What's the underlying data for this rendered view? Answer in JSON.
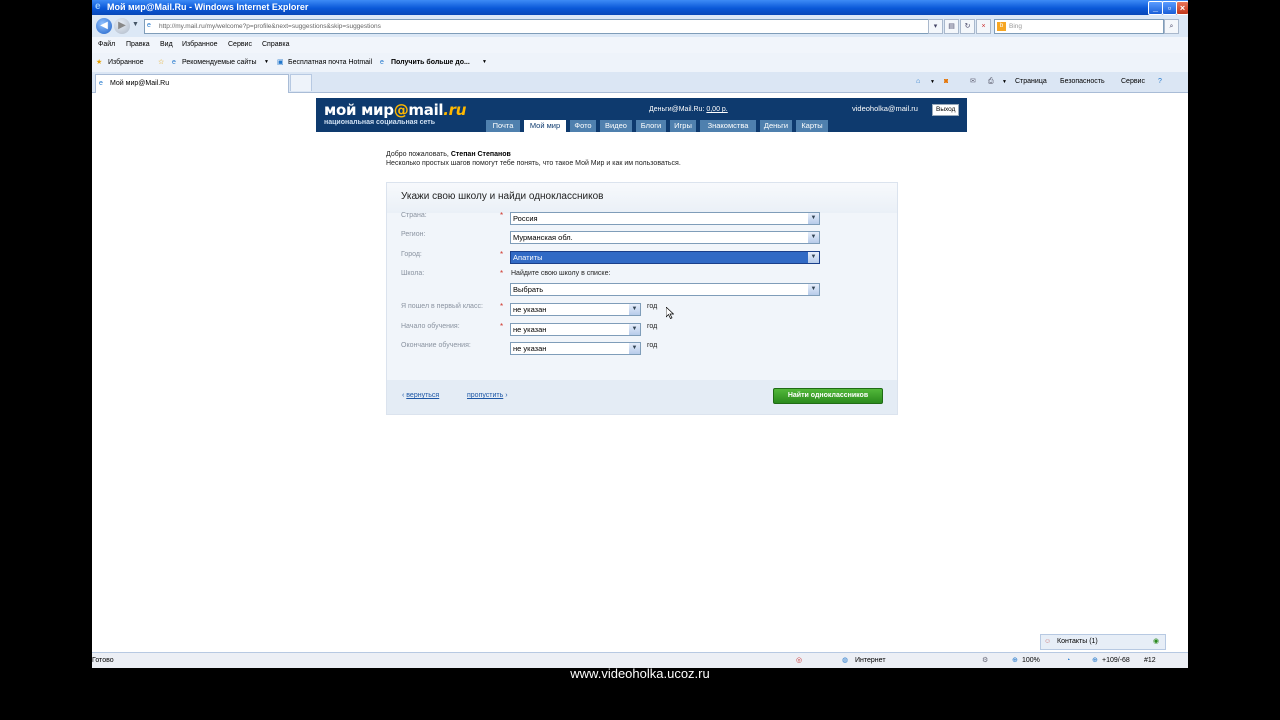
{
  "window": {
    "title": "Мой мир@Mail.Ru - Windows Internet Explorer"
  },
  "address": {
    "url": "http://my.mail.ru/my/welcome?p=profile&next=suggestions&skip=suggestions",
    "search_placeholder": "Bing"
  },
  "menu": [
    "Файл",
    "Правка",
    "Вид",
    "Избранное",
    "Сервис",
    "Справка"
  ],
  "favorites": {
    "fav": "Избранное",
    "recommended": "Рекомендуемые сайты",
    "hotmail": "Бесплатная почта Hotmail",
    "more": "Получить больше до..."
  },
  "tab": {
    "label": "Мой мир@Mail.Ru"
  },
  "commandbar": {
    "page": "Страница",
    "security": "Безопасность",
    "tools": "Сервис"
  },
  "site": {
    "logo_main": "мой мир",
    "logo_at": "@",
    "logo_mail": "mail",
    "logo_ru": ".ru",
    "logo_sub": "национальная социальная сеть",
    "money_label": "Деньги@Mail.Ru:",
    "money_value": "0,00 р.",
    "user_email": "videoholka@mail.ru",
    "exit": "Выход",
    "nav": [
      "Почта",
      "Мой мир",
      "Фото",
      "Видео",
      "Блоги",
      "Игры",
      "Знакомства",
      "Деньги",
      "Карты"
    ],
    "nav_active": "Мой мир"
  },
  "welcome": {
    "greet": "Добро пожаловать,",
    "name": "Степан Степанов",
    "line2": "Несколько простых шагов помогут тебе понять, что такое Мой Мир и как им пользоваться."
  },
  "form": {
    "title": "Укажи свою школу и найди одноклассников",
    "country_label": "Страна:",
    "country_value": "Россия",
    "region_label": "Регион:",
    "region_value": "Мурманская обл.",
    "city_label": "Город:",
    "city_value": "Апатиты",
    "school_label": "Школа:",
    "school_hint": "Найдите свою школу в списке:",
    "school_value": "Выбрать",
    "first_class_label": "Я пошел в первый класс:",
    "first_class_value": "не указан",
    "start_label": "Начало обучения:",
    "start_value": "не указан",
    "end_label": "Окончание обучения:",
    "end_value": "не указан",
    "year": "год",
    "back": "вернуться",
    "skip": "пропустить",
    "submit": "Найти одноклассников"
  },
  "contacts": {
    "label": "Контакты",
    "count": "(1)"
  },
  "status": {
    "ready": "Готово",
    "zone": "Интернет",
    "zoom": "100%",
    "extra": "+109/-68",
    "num": "#12"
  },
  "caption": "www.videoholka.ucoz.ru"
}
